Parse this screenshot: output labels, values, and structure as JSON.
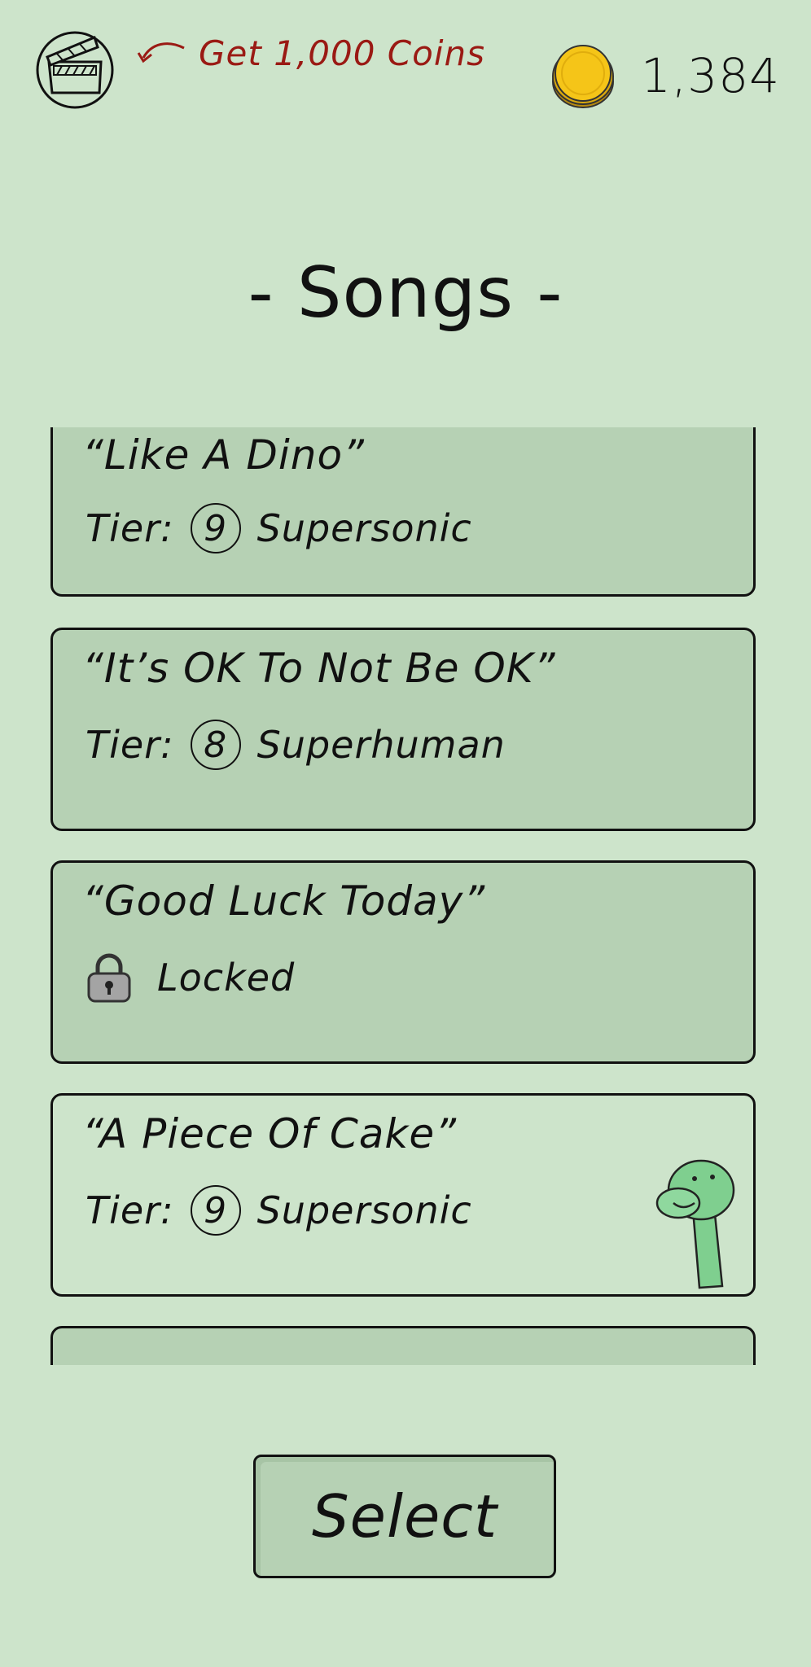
{
  "header": {
    "offer_text": "Get 1,000 Coins",
    "coin_balance": "1,384"
  },
  "title": "- Songs -",
  "songs": [
    {
      "title": "“Like A Dino”",
      "tier_label": "Tier:",
      "tier_num": "9",
      "tier_name": "Supersonic"
    },
    {
      "title": "“It’s OK To Not Be OK”",
      "tier_label": "Tier:",
      "tier_num": "8",
      "tier_name": "Superhuman"
    },
    {
      "title": "“Good Luck Today”",
      "status": "Locked"
    },
    {
      "title": "“A Piece Of Cake”",
      "tier_label": "Tier:",
      "tier_num": "9",
      "tier_name": "Supersonic",
      "selected": true
    }
  ],
  "select_label": "Select",
  "colors": {
    "background": "#cde4cb",
    "card": "#b6d1b4",
    "selected_card": "#cde4cb",
    "offer_red": "#9a1a14",
    "coin_gold": "#f5c518",
    "dino_green": "#7fcf8f"
  },
  "icons": [
    "video-clapper-icon",
    "curved-arrow-icon",
    "coin-stack-icon",
    "lock-icon",
    "dino-icon"
  ]
}
